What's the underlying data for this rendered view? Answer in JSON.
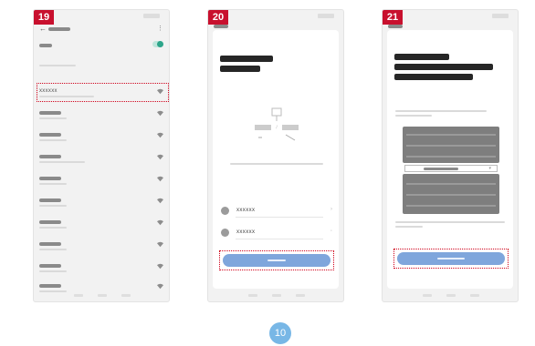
{
  "steps": {
    "step1": "19",
    "step2": "20",
    "step3": "21"
  },
  "wifi_list": {
    "selected_network": "xxxxxx"
  },
  "password_screen": {
    "network_name": "xxxxxx",
    "password_value": "xxxxxx"
  },
  "page_number": "10",
  "colors": {
    "badge": "#c8102e",
    "highlight": "#d0021b",
    "button": "#7fa6dc",
    "page_circle": "#78b7e6"
  }
}
